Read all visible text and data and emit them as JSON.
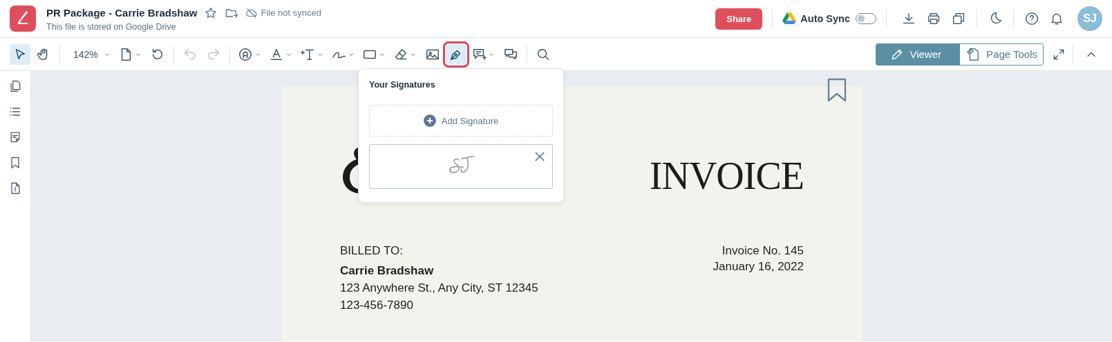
{
  "header": {
    "title": "PR Package - Carrie Bradshaw",
    "subtitle": "This file is stored on Google Drive",
    "sync_status": "File not synced",
    "share": "Share",
    "auto_sync": {
      "label": "Auto Sync",
      "on": false
    },
    "avatar": "SJ"
  },
  "toolbar": {
    "groups": [
      {
        "tools": [
          {
            "kind": "tool",
            "selected": true,
            "disabled": false,
            "menu": false,
            "marked": false
          },
          {
            "kind": "tool",
            "selected": false,
            "disabled": false,
            "menu": false,
            "marked": false
          }
        ]
      },
      {
        "tools": [
          {
            "kind": "zoom",
            "label": "142%",
            "selected": false,
            "disabled": false,
            "menu": true,
            "marked": false
          },
          {
            "kind": "tool",
            "selected": false,
            "disabled": false,
            "menu": true,
            "marked": false
          },
          {
            "kind": "tool",
            "selected": false,
            "disabled": false,
            "menu": false,
            "marked": false
          }
        ]
      },
      {
        "tools": [
          {
            "kind": "tool",
            "selected": false,
            "disabled": true,
            "menu": false,
            "marked": false
          },
          {
            "kind": "tool",
            "selected": false,
            "disabled": true,
            "menu": false,
            "marked": false
          }
        ]
      },
      {
        "tools": [
          {
            "kind": "tool",
            "selected": false,
            "disabled": false,
            "menu": true,
            "marked": false
          },
          {
            "kind": "tool",
            "selected": false,
            "disabled": false,
            "menu": true,
            "marked": false
          },
          {
            "kind": "tool",
            "selected": false,
            "disabled": false,
            "menu": true,
            "marked": false
          },
          {
            "kind": "tool",
            "selected": false,
            "disabled": false,
            "menu": true,
            "marked": false
          },
          {
            "kind": "tool",
            "selected": false,
            "disabled": false,
            "menu": true,
            "marked": false
          },
          {
            "kind": "tool",
            "selected": false,
            "disabled": false,
            "menu": true,
            "marked": false
          },
          {
            "kind": "tool",
            "selected": false,
            "disabled": false,
            "menu": false,
            "marked": false
          },
          {
            "kind": "tool",
            "selected": true,
            "disabled": false,
            "menu": false,
            "marked": true
          },
          {
            "kind": "tool",
            "selected": false,
            "disabled": false,
            "menu": true,
            "marked": false
          },
          {
            "kind": "tool",
            "selected": false,
            "disabled": false,
            "menu": false,
            "marked": false
          }
        ]
      },
      {
        "tools": [
          {
            "kind": "tool",
            "selected": false,
            "disabled": false,
            "menu": false,
            "marked": false
          }
        ]
      }
    ],
    "modes": [
      {
        "label": "Viewer",
        "selected": true
      },
      {
        "label": "Page Tools",
        "selected": false
      }
    ]
  },
  "signature_popup": {
    "title": "Your Signatures",
    "add_label": "Add Signature"
  },
  "document": {
    "title": "INVOICE",
    "billed_to_label": "BILLED TO:",
    "client_name": "Carrie Bradshaw",
    "address_lines": [
      "123 Anywhere St., Any City, ST 12345",
      "123-456-7890"
    ],
    "invoice_lines": [
      "Invoice No. 145",
      "January 16, 2022"
    ]
  }
}
